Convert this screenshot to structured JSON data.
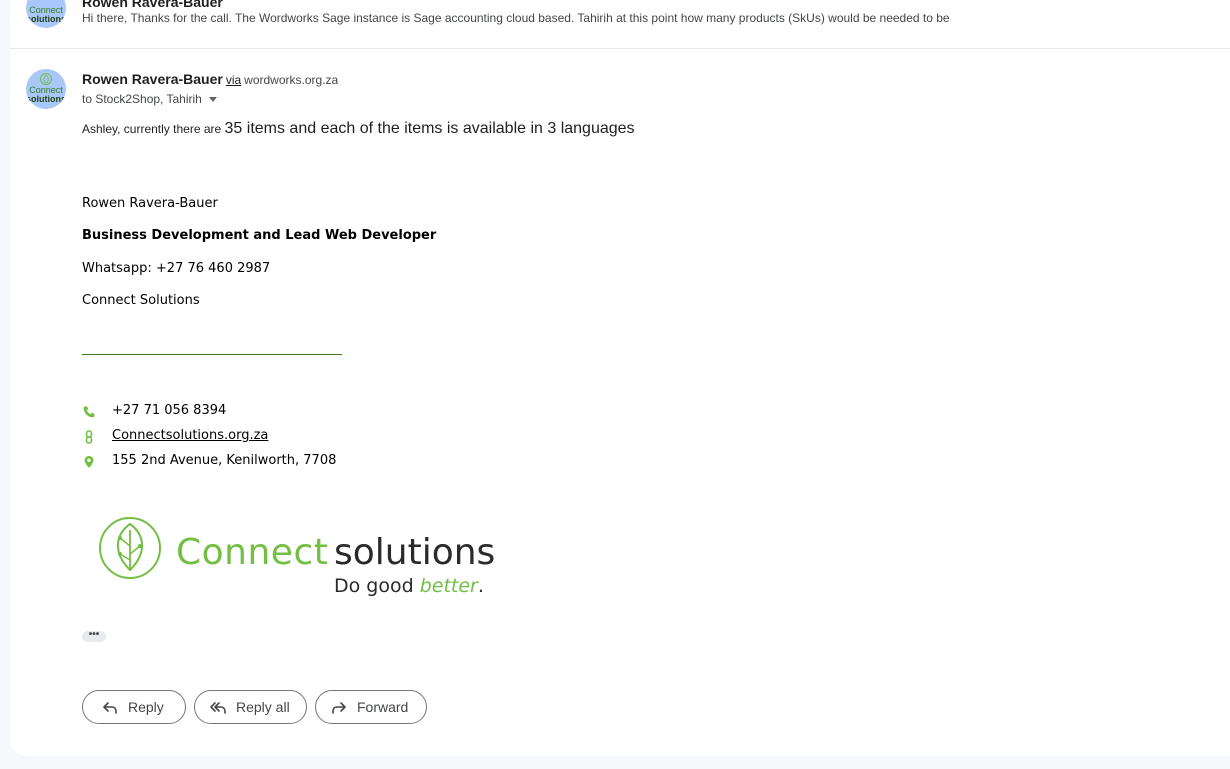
{
  "collapsed_message": {
    "sender": "Rowen Ravera-Bauer",
    "snippet": "Hi there, Thanks for the call. The Wordworks Sage instance is Sage accounting cloud based. Tahirih at this point how many products (SkUs) would be needed to be"
  },
  "avatar": {
    "line1": "Connect",
    "line2": "solutions"
  },
  "message": {
    "sender_name": "Rowen Ravera-Bauer",
    "via_label": "via",
    "via_domain": "wordworks.org.za",
    "to_line": "to Stock2Shop, Tahirih",
    "body_part1": "Ashley, currently there are ",
    "body_part2": "35 items and each of the items is available in 3 languages"
  },
  "signature": {
    "name": "Rowen Ravera-Bauer",
    "title": "Business Development and Lead Web Developer",
    "whatsapp": "Whatsapp: +27 76 460 2987",
    "company": "Connect Solutions",
    "phone": "+27 71 056 8394",
    "website": "Connectsolutions.org.za",
    "address": "155 2nd Avenue, Kenilworth, 7708",
    "phone_icon": "phone-icon",
    "link_icon": "link-icon",
    "location_icon": "location-pin-icon"
  },
  "logo": {
    "word1": "Connect",
    "word2": "solutions",
    "tagline_part1": "Do good ",
    "tagline_part2": "better",
    "tagline_part3": "."
  },
  "more_label": "•••",
  "actions": {
    "reply": "Reply",
    "reply_all": "Reply all",
    "forward": "Forward"
  },
  "colors": {
    "brand_green": "#72bf44",
    "page_background": "#f6f8fc",
    "avatar_background": "#a8c7fa"
  }
}
